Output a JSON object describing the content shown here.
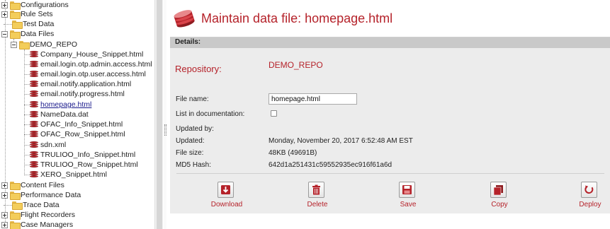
{
  "tree": {
    "items": [
      {
        "label": "Configurations"
      },
      {
        "label": "Rule Sets"
      },
      {
        "label": "Test Data"
      },
      {
        "label": "Data Files"
      },
      {
        "label": "DEMO_REPO"
      },
      {
        "label": "Company_House_Snippet.html"
      },
      {
        "label": "email.login.otp.admin.access.html"
      },
      {
        "label": "email.login.otp.user.access.html"
      },
      {
        "label": "email.notify.application.html"
      },
      {
        "label": "email.notify.progress.html"
      },
      {
        "label": "homepage.html"
      },
      {
        "label": "NameData.dat"
      },
      {
        "label": "OFAC_Info_Snippet.html"
      },
      {
        "label": "OFAC_Row_Snippet.html"
      },
      {
        "label": "sdn.xml"
      },
      {
        "label": "TRULIOO_Info_Snippet.html"
      },
      {
        "label": "TRULIOO_Row_Snippet.html"
      },
      {
        "label": "XERO_Snippet.html"
      },
      {
        "label": "Content Files"
      },
      {
        "label": "Performance Data"
      },
      {
        "label": "Trace Data"
      },
      {
        "label": "Flight Recorders"
      },
      {
        "label": "Case Managers"
      }
    ]
  },
  "header": {
    "title": "Maintain data file: homepage.html",
    "icon": "database-icon"
  },
  "details": {
    "heading": "Details:",
    "repository_label": "Repository:",
    "repository_value": "DEMO_REPO",
    "file_name_label": "File name:",
    "file_name_value": "homepage.html",
    "list_in_doc_label": "List in documentation:",
    "list_in_doc_checked": false,
    "updated_by_label": "Updated by:",
    "updated_label": "Updated:",
    "updated_value": "Monday, November 20, 2017 6:52:48 AM EST",
    "file_size_label": "File size:",
    "file_size_value": "48KB (49691B)",
    "md5_label": "MD5 Hash:",
    "md5_value": "642d1a251431c59552935ec916f61a6d"
  },
  "actions": {
    "download": "Download",
    "delete": "Delete",
    "save": "Save",
    "copy": "Copy",
    "deploy": "Deploy"
  },
  "colors": {
    "accent": "#b5222a",
    "folder": "#f3cd5b",
    "panel": "#ececec",
    "panel_header": "#c9c9c9"
  }
}
